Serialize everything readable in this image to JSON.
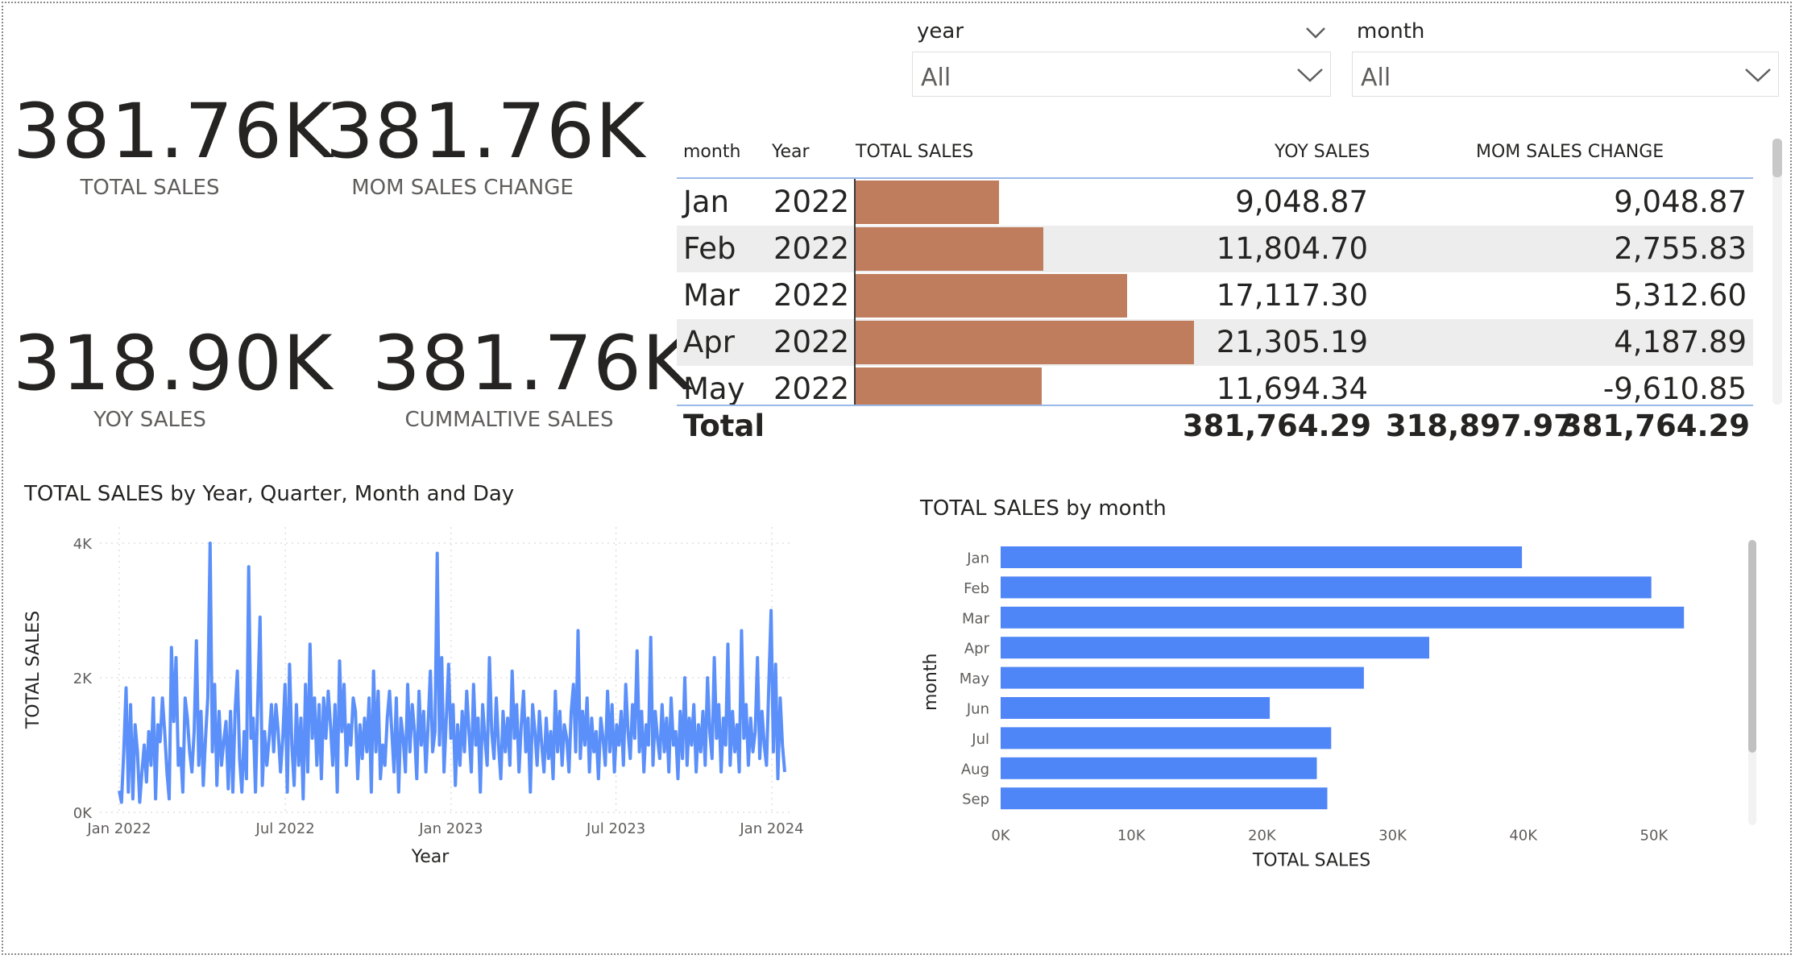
{
  "kpis": [
    {
      "value": "381.76K",
      "label": "TOTAL SALES"
    },
    {
      "value": "381.76K",
      "label": "MOM SALES CHANGE"
    },
    {
      "value": "318.90K",
      "label": "YOY SALES"
    },
    {
      "value": "381.76K",
      "label": "CUMMALTIVE SALES"
    }
  ],
  "slicers": {
    "year": {
      "title": "year",
      "value": "All"
    },
    "month": {
      "title": "month",
      "value": "All"
    }
  },
  "table": {
    "headers": [
      "month",
      "Year",
      "TOTAL SALES",
      "YOY SALES",
      "MOM SALES CHANGE"
    ],
    "rows": [
      {
        "month": "Jan",
        "year": "2022",
        "total_sales": "9,048.87",
        "total_sales_value": 9048.87,
        "yoy_sales": "",
        "mom_change": "9,048.87"
      },
      {
        "month": "Feb",
        "year": "2022",
        "total_sales": "11,804.70",
        "total_sales_value": 11804.7,
        "yoy_sales": "",
        "mom_change": "2,755.83"
      },
      {
        "month": "Mar",
        "year": "2022",
        "total_sales": "17,117.30",
        "total_sales_value": 17117.3,
        "yoy_sales": "",
        "mom_change": "5,312.60"
      },
      {
        "month": "Apr",
        "year": "2022",
        "total_sales": "21,305.19",
        "total_sales_value": 21305.19,
        "yoy_sales": "",
        "mom_change": "4,187.89"
      },
      {
        "month": "May",
        "year": "2022",
        "total_sales": "11,694.34",
        "total_sales_value": 11694.34,
        "yoy_sales": "",
        "mom_change": "-9,610.85"
      }
    ],
    "total": {
      "label": "Total",
      "total_sales": "381,764.29",
      "yoy_sales": "318,897.97",
      "mom_change": "381,764.29"
    },
    "bar_max_value": 21305.19,
    "bar_color": "#bf7d5d"
  },
  "line_chart": {
    "title": "TOTAL SALES by Year, Quarter, Month and Day",
    "xlabel": "Year",
    "ylabel": "TOTAL SALES",
    "y_ticks": [
      "0K",
      "2K",
      "4K"
    ],
    "x_ticks": [
      "Jan 2022",
      "Jul 2022",
      "Jan 2023",
      "Jul 2023",
      "Jan 2024"
    ],
    "color": "#5b8ff9"
  },
  "bar_chart": {
    "title": "TOTAL SALES by month",
    "xlabel": "TOTAL SALES",
    "ylabel": "month",
    "x_ticks": [
      "0K",
      "10K",
      "20K",
      "30K",
      "40K",
      "50K"
    ],
    "color": "#4f86f7"
  },
  "chart_data": [
    {
      "type": "line",
      "title": "TOTAL SALES by Year, Quarter, Month and Day",
      "xlabel": "Year",
      "ylabel": "TOTAL SALES",
      "x_range": [
        "2022-01-01",
        "2024-05-31"
      ],
      "ylim": [
        0,
        4000
      ],
      "series": [
        {
          "values": [
            320,
            150,
            900,
            1850,
            300,
            1600,
            200,
            1300,
            900,
            150,
            600,
            1000,
            450,
            1200,
            700,
            1700,
            200,
            1300,
            1050,
            1700,
            1200,
            600,
            200,
            2450,
            1350,
            2300,
            700,
            950,
            300,
            1700,
            1400,
            900,
            600,
            1200,
            2550,
            700,
            1500,
            400,
            1100,
            1700,
            4000,
            900,
            1900,
            400,
            1500,
            700,
            1050,
            1350,
            350,
            1500,
            300,
            1500,
            2100,
            800,
            300,
            1200,
            500,
            3650,
            1100,
            1400,
            300,
            1700,
            2900,
            400,
            1200,
            700,
            1100,
            1600,
            900,
            1600,
            1200,
            600,
            1100,
            1900,
            300,
            2200,
            1000,
            400,
            1600,
            700,
            1400,
            200,
            1900,
            600,
            2500,
            1100,
            1700,
            700,
            1600,
            500,
            1700,
            1100,
            1800,
            1300,
            700,
            1600,
            300,
            2250,
            1200,
            1900,
            700,
            1300,
            1000,
            1700,
            1500,
            500,
            1300,
            800,
            1400,
            900,
            1700,
            300,
            2100,
            900,
            1800,
            500,
            1000,
            700,
            1400,
            1800,
            1200,
            600,
            1700,
            300,
            1400,
            1100,
            600,
            1900,
            900,
            1600,
            1200,
            500,
            1800,
            1000,
            1500,
            600,
            1300,
            2100,
            900,
            1200,
            3850,
            1000,
            2300,
            600,
            1400,
            2200,
            1100,
            1600,
            400,
            1300,
            700,
            1500,
            900,
            1800,
            1200,
            600,
            1900,
            1000,
            1400,
            300,
            1600,
            1100,
            700,
            2300,
            1200,
            800,
            1700,
            1000,
            500,
            1500,
            900,
            1400,
            700,
            2100,
            1100,
            1600,
            600,
            1300,
            1800,
            900,
            1400,
            300,
            1600,
            1200,
            700,
            1500,
            1000,
            600,
            1400,
            800,
            1200,
            500,
            1800,
            900,
            1500,
            700,
            1300,
            1100,
            600,
            1500,
            1900,
            900,
            2700,
            800,
            1500,
            1000,
            1700,
            600,
            1400,
            900,
            1200,
            500,
            1400,
            1100,
            700,
            1800,
            900,
            1600,
            600,
            1300,
            1000,
            1500,
            700,
            1900,
            1200,
            800,
            1600,
            1100,
            2400,
            900,
            1500,
            600,
            1300,
            1000,
            2600,
            700,
            1500,
            1100,
            800,
            1600,
            900,
            1400,
            600,
            1700,
            1000,
            1200,
            500,
            1500,
            800,
            2000,
            700,
            1400,
            1000,
            1600,
            600,
            1300,
            900,
            1500,
            700,
            2000,
            1200,
            800,
            2300,
            1100,
            1600,
            600,
            1400,
            1000,
            2500,
            700,
            1500,
            900,
            1300,
            600,
            2700,
            1100,
            1600,
            700,
            1400,
            900,
            1200,
            2300,
            800,
            1500,
            1000,
            700,
            1900,
            3000,
            900,
            2200,
            500,
            1700,
            1000,
            600
          ]
        }
      ]
    },
    {
      "type": "bar",
      "orientation": "horizontal",
      "title": "TOTAL SALES by month",
      "xlabel": "TOTAL SALES",
      "ylabel": "month",
      "categories": [
        "Jan",
        "Feb",
        "Mar",
        "Apr",
        "May",
        "Jun",
        "Jul",
        "Aug",
        "Sep"
      ],
      "values": [
        39900,
        49800,
        52300,
        32800,
        27800,
        20600,
        25300,
        24200,
        25000
      ],
      "xlim": [
        0,
        55000
      ]
    }
  ]
}
